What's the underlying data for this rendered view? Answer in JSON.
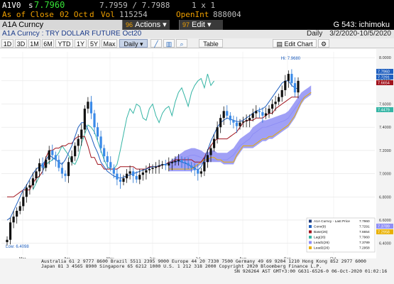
{
  "header": {
    "ticker": "A1V0",
    "last_prefix": "s",
    "last_price": "7.7960",
    "bid_ask": "7.7959 / 7.7988",
    "size": "1 x 1",
    "close_label": "As of Close",
    "close_date": "02 Oct",
    "close_flag": "d",
    "vol_label": "Vol",
    "vol_value": "115254",
    "openint_label": "OpenInt",
    "openint_value": "888004"
  },
  "titlebar": {
    "security": "A1A Curncy",
    "actions_num": "96",
    "actions_label": "Actions",
    "edit_num": "97",
    "edit_label": "Edit",
    "function": "G 543: ichimoku"
  },
  "subtitle": {
    "name": "A1A Curncy : TRY DOLLAR FUTURE Oct20",
    "period": "Daily",
    "range": "3/2/2020-10/5/2020"
  },
  "toolbar": {
    "buttons": [
      "1D",
      "3D",
      "1M",
      "6M",
      "YTD",
      "1Y",
      "5Y",
      "Max"
    ],
    "frequency": "Daily",
    "table": "Table",
    "edit_chart": "Edit Chart"
  },
  "chart_data": {
    "type": "line",
    "title": "",
    "y_ticks": [
      "8.0000",
      "7.8000",
      "7.6000",
      "7.4000",
      "7.2000",
      "7.0000",
      "6.8000",
      "6.6000",
      "6.4000"
    ],
    "ylim": [
      6.3,
      8.05
    ],
    "x_months": [
      "Mar",
      "Apr",
      "May",
      "Jun",
      "Jul",
      "Aug",
      "Sep",
      "Oct"
    ],
    "x_year": "2020",
    "high_label": "Hi: 7.9680",
    "low_label": "Low: 6.4098",
    "price_labels": [
      {
        "value": "7.7960",
        "color": "#1f5fbf"
      },
      {
        "value": "7.7291",
        "color": "#1f5fbf"
      },
      {
        "value": "7.6654",
        "color": "#a0121c"
      },
      {
        "value": "7.4479",
        "color": "#35b5a5"
      },
      {
        "value": "7.3789",
        "color": "#8f8ff5"
      },
      {
        "value": "7.2958",
        "color": "#e8b000"
      }
    ],
    "legend": [
      {
        "name": "A1A Curncy - Last Price",
        "value": "7.7960",
        "color": "#1f3a7a"
      },
      {
        "name": "Conv(9)",
        "value": "7.7291",
        "color": "#1f5fbf"
      },
      {
        "name": "Base(26)",
        "value": "7.6654",
        "color": "#a0121c"
      },
      {
        "name": "Lag(26)",
        "value": "7.7960",
        "color": "#35b5a5"
      },
      {
        "name": "Lead1(26)",
        "value": "7.3789",
        "color": "#8f8ff5"
      },
      {
        "name": "Lead2(26)",
        "value": "7.2958",
        "color": "#e8b000"
      }
    ],
    "series": {
      "close": [
        6.43,
        6.58,
        6.63,
        6.68,
        6.72,
        6.8,
        6.88,
        6.9,
        6.96,
        7.02,
        7.09,
        7.05,
        7.12,
        7.2,
        7.16,
        7.12,
        7.05,
        7.0,
        6.98,
        7.1,
        7.15,
        7.24,
        7.3,
        7.38,
        7.56,
        7.62,
        7.52,
        7.4,
        7.32,
        7.22,
        7.15,
        7.1,
        7.05,
        7.0,
        6.95,
        6.93,
        6.96,
        7.0,
        7.02,
        6.98,
        6.95,
        6.99,
        7.01,
        7.03,
        7.04,
        7.05,
        7.06,
        7.07,
        7.08,
        7.07,
        7.09,
        7.1,
        7.11,
        7.12,
        7.1,
        7.09,
        7.07,
        7.05,
        7.03,
        7.0,
        7.02,
        7.1,
        7.16,
        7.22,
        7.3,
        7.4,
        7.48,
        7.54,
        7.5,
        7.46,
        7.44,
        7.41,
        7.44,
        7.45,
        7.46,
        7.48,
        7.52,
        7.54,
        7.53,
        7.5,
        7.52,
        7.56,
        7.6,
        7.62,
        7.66,
        7.72,
        7.8,
        7.86,
        7.78,
        7.7,
        7.8
      ],
      "conv": [
        6.6,
        6.62,
        6.68,
        6.74,
        6.8,
        6.86,
        6.9,
        6.95,
        7.0,
        7.04,
        7.06,
        7.08,
        7.12,
        7.16,
        7.14,
        7.12,
        7.1,
        7.08,
        7.12,
        7.18,
        7.24,
        7.32,
        7.4,
        7.44,
        7.44,
        7.38,
        7.32,
        7.24,
        7.18,
        7.1,
        7.06,
        7.02,
        7.0,
        6.98,
        6.97,
        6.96,
        6.97,
        6.98,
        6.99,
        7.0,
        7.01,
        7.02,
        7.03,
        7.04,
        7.05,
        7.06,
        7.06,
        7.07,
        7.08,
        7.08,
        7.09,
        7.1,
        7.1,
        7.11,
        7.1,
        7.09,
        7.08,
        7.06,
        7.05,
        7.03,
        7.06,
        7.12,
        7.2,
        7.28,
        7.34,
        7.4,
        7.44,
        7.46,
        7.48,
        7.47,
        7.46,
        7.45,
        7.45,
        7.46,
        7.48,
        7.5,
        7.52,
        7.54,
        7.55,
        7.56,
        7.58,
        7.62,
        7.66,
        7.7,
        7.74,
        7.78,
        7.8,
        7.8,
        7.76,
        7.74,
        7.73
      ],
      "base": [
        6.8,
        6.8,
        6.8,
        6.82,
        6.84,
        6.86,
        6.86,
        6.86,
        6.92,
        6.96,
        6.98,
        7.02,
        7.14,
        7.2,
        7.2,
        7.22,
        7.22,
        7.24,
        7.24,
        7.26,
        7.26,
        7.3,
        7.32,
        7.32,
        7.32,
        7.24,
        7.14,
        7.14,
        7.08,
        7.08,
        7.04,
        7.04,
        7.04,
        7.04,
        7.04,
        7.06,
        7.06,
        7.06,
        7.06,
        7.06,
        7.04,
        7.04,
        7.04,
        7.04,
        7.06,
        7.06,
        7.06,
        7.06,
        7.08,
        7.08,
        7.1,
        7.1,
        7.12,
        7.12,
        7.12,
        7.12,
        7.12,
        7.12,
        7.1,
        7.1,
        7.1,
        7.14,
        7.2,
        7.24,
        7.28,
        7.3,
        7.3,
        7.3,
        7.3,
        7.32,
        7.34,
        7.36,
        7.4,
        7.44,
        7.46,
        7.46,
        7.46,
        7.48,
        7.48,
        7.48,
        7.5,
        7.52,
        7.52,
        7.56,
        7.58,
        7.6,
        7.62,
        7.64,
        7.66,
        7.66,
        7.66
      ],
      "lag": [
        6.86,
        6.92,
        6.98,
        7.02,
        7.08,
        7.1,
        7.12,
        7.14,
        7.18,
        7.24,
        7.2,
        7.16,
        7.1,
        7.08,
        7.14,
        7.26,
        7.34,
        7.42,
        7.4,
        7.36,
        7.28,
        7.2,
        7.12,
        7.06,
        7.04,
        7.04,
        7.08,
        7.2,
        7.34,
        7.48,
        7.56,
        7.52,
        7.6,
        7.58,
        7.48,
        7.46,
        7.56,
        7.6,
        7.5,
        7.44,
        7.52,
        7.56,
        7.58,
        7.5,
        7.62,
        7.7,
        7.74,
        7.66,
        7.58,
        7.7,
        7.76,
        7.8,
        7.82,
        7.74,
        7.86,
        7.76,
        7.8
      ],
      "lead1": [
        7.04,
        7.06,
        7.08,
        7.1,
        7.12,
        7.14,
        7.15,
        7.16,
        7.16,
        7.15,
        7.14,
        7.12,
        7.12,
        7.12,
        7.12,
        7.12,
        7.12,
        7.12,
        7.12,
        7.14,
        7.16,
        7.2,
        7.24,
        7.26,
        7.28,
        7.3,
        7.34,
        7.36,
        7.38,
        7.4,
        7.4,
        7.41,
        7.42,
        7.43,
        7.44,
        7.45,
        7.46,
        7.48,
        7.52,
        7.56,
        7.6,
        7.64,
        7.66,
        7.68,
        7.7
      ],
      "lead2": [
        7.04,
        7.04,
        7.04,
        7.04,
        7.04,
        7.04,
        7.04,
        7.04,
        7.06,
        7.08,
        7.1,
        7.12,
        7.12,
        7.14,
        7.14,
        7.12,
        7.12,
        7.1,
        7.1,
        7.1,
        7.1,
        7.16,
        7.2,
        7.24,
        7.24,
        7.24,
        7.24,
        7.26,
        7.28,
        7.3,
        7.3,
        7.32,
        7.32,
        7.34,
        7.36,
        7.38,
        7.4,
        7.42,
        7.46,
        7.5,
        7.56,
        7.62,
        7.66,
        7.68,
        7.7
      ]
    }
  },
  "footer": {
    "line1": "Australia 61 2 9777 8600 Brazil 5511 2395 9000 Europe 44 20 7330 7500 Germany 49 69 9204 1210 Hong Kong 852 2977 6000",
    "line2": "Japan 81 3 4565 8900        Singapore 65 6212 1000        U.S. 1 212 318 2000            Copyright 2020 Bloomberg Finance L.P.",
    "line3": "SN 926264 AST  GMT+3:00 G631-6526-0 06-Oct-2020 01:02:16"
  }
}
